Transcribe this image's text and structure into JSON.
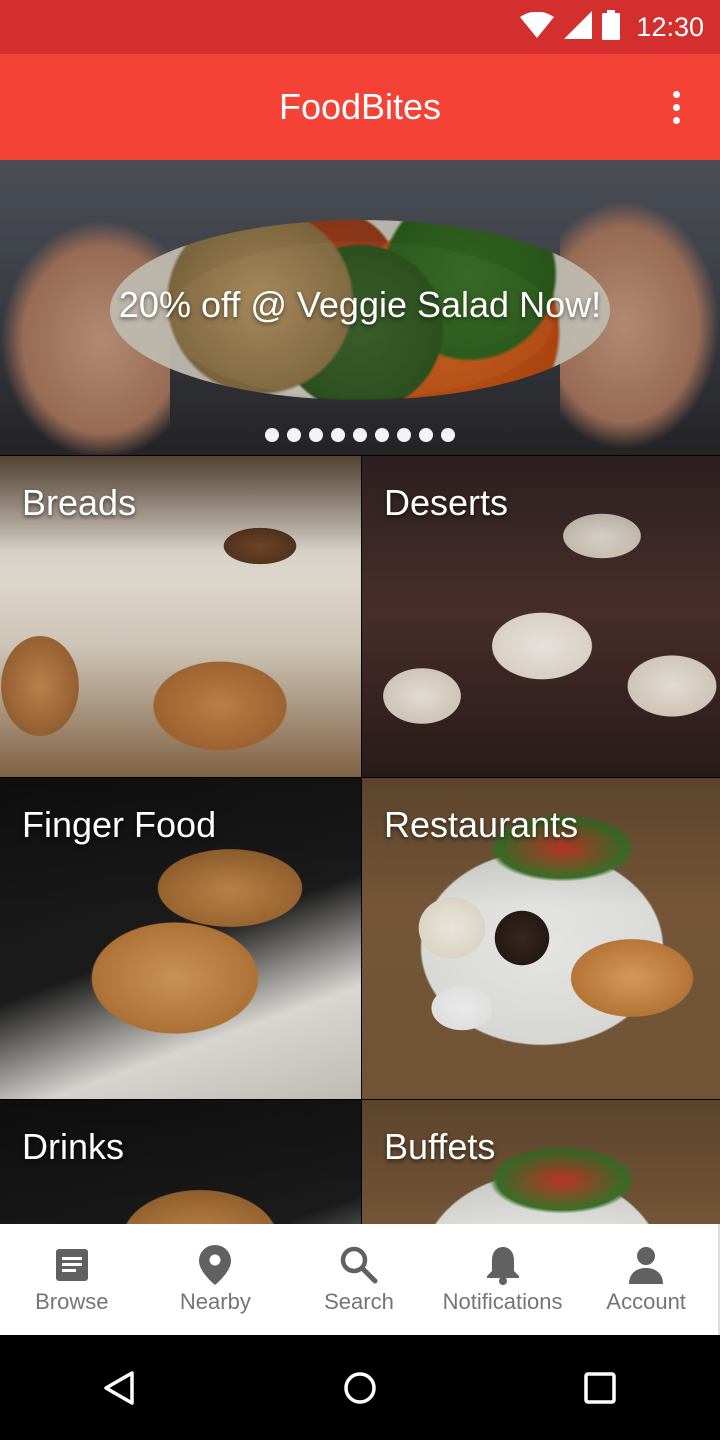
{
  "status_bar": {
    "time": "12:30",
    "icons": [
      "wifi-icon",
      "cell-signal-icon",
      "battery-icon"
    ]
  },
  "app_bar": {
    "title": "FoodBites",
    "menu_icon": "more-vert-icon"
  },
  "banner": {
    "promo_text": "20% off @ Veggie Salad Now!",
    "slide_count": 9
  },
  "categories": [
    {
      "label": "Breads"
    },
    {
      "label": "Deserts"
    },
    {
      "label": "Finger Food"
    },
    {
      "label": "Restaurants"
    },
    {
      "label": "Drinks"
    },
    {
      "label": "Buffets"
    }
  ],
  "bottom_nav": [
    {
      "label": "Browse",
      "icon": "browse-icon"
    },
    {
      "label": "Nearby",
      "icon": "location-pin-icon"
    },
    {
      "label": "Search",
      "icon": "search-icon"
    },
    {
      "label": "Notifications",
      "icon": "bell-icon"
    },
    {
      "label": "Account",
      "icon": "person-icon"
    }
  ],
  "colors": {
    "status_bar": "#d32f2f",
    "app_bar": "#f44336",
    "nav_icon": "#616161",
    "nav_text": "#757575"
  },
  "system_nav": [
    "back-icon",
    "home-icon",
    "recents-icon"
  ]
}
